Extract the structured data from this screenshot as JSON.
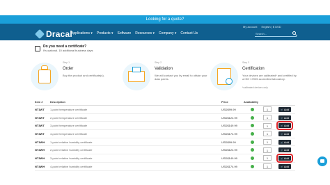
{
  "banner": {
    "text": "Looking for a quote?"
  },
  "header": {
    "brand": "Dracal",
    "nav": [
      "Applications ▾",
      "Products ▾",
      "Software",
      "Resources ▾",
      "Company ▾",
      "Contact Us"
    ],
    "util": [
      "My account",
      "English | $ USD"
    ],
    "search_placeholder": "Search..."
  },
  "intro": {
    "title": "Do you need a certificate?",
    "subtitle": "It's optional. 10 additional business days"
  },
  "steps": [
    {
      "label": "Step 1",
      "title": "Order",
      "desc": "Buy the product and certificate(s).",
      "note": ""
    },
    {
      "label": "Step 2",
      "title": "Validation",
      "desc": "We will contact you by email to obtain your data points.",
      "note": ""
    },
    {
      "label": "Step 3",
      "title": "Certification",
      "desc": "Your devices are calibrated* and certified by a ISO 17025 accredited laboratory.",
      "note": "*calibrated devices only"
    }
  ],
  "table": {
    "headers": {
      "item": "Item #",
      "desc": "Description",
      "price": "Price",
      "avail": "Availability"
    },
    "rows": [
      {
        "item": "NT1WT",
        "desc": "1-point temperature certificate",
        "price": "USD$99.99",
        "qty": "1",
        "add": "Add"
      },
      {
        "item": "NT2WT",
        "desc": "2-point temperature certificate",
        "price": "USD$124.99",
        "qty": "1",
        "add": "Add"
      },
      {
        "item": "NT3WT",
        "desc": "3-point temperature certificate",
        "price": "USD$149.99",
        "qty": "1",
        "add": "Add"
      },
      {
        "item": "NT4WT",
        "desc": "4-point temperature certificate",
        "price": "USD$174.99",
        "qty": "1",
        "add": "Add"
      },
      {
        "item": "NT1WH",
        "desc": "1-point relative humidity certificate",
        "price": "USD$99.99",
        "qty": "1",
        "add": "Add"
      },
      {
        "item": "NT2WH",
        "desc": "2-point relative humidity certificate",
        "price": "USD$124.99",
        "qty": "1",
        "add": "Add"
      },
      {
        "item": "NT3WH",
        "desc": "3-point relative humidity certificate",
        "price": "USD$149.99",
        "qty": "1",
        "add": "Add"
      },
      {
        "item": "NT4WH",
        "desc": "4-point relative humidity certificate",
        "price": "USD$174.99",
        "qty": "1",
        "add": "Add"
      }
    ]
  },
  "colors": {
    "primary": "#0f5f8f",
    "banner": "#1a9fd9",
    "highlight": "#e0262b",
    "available": "#46b04a"
  }
}
